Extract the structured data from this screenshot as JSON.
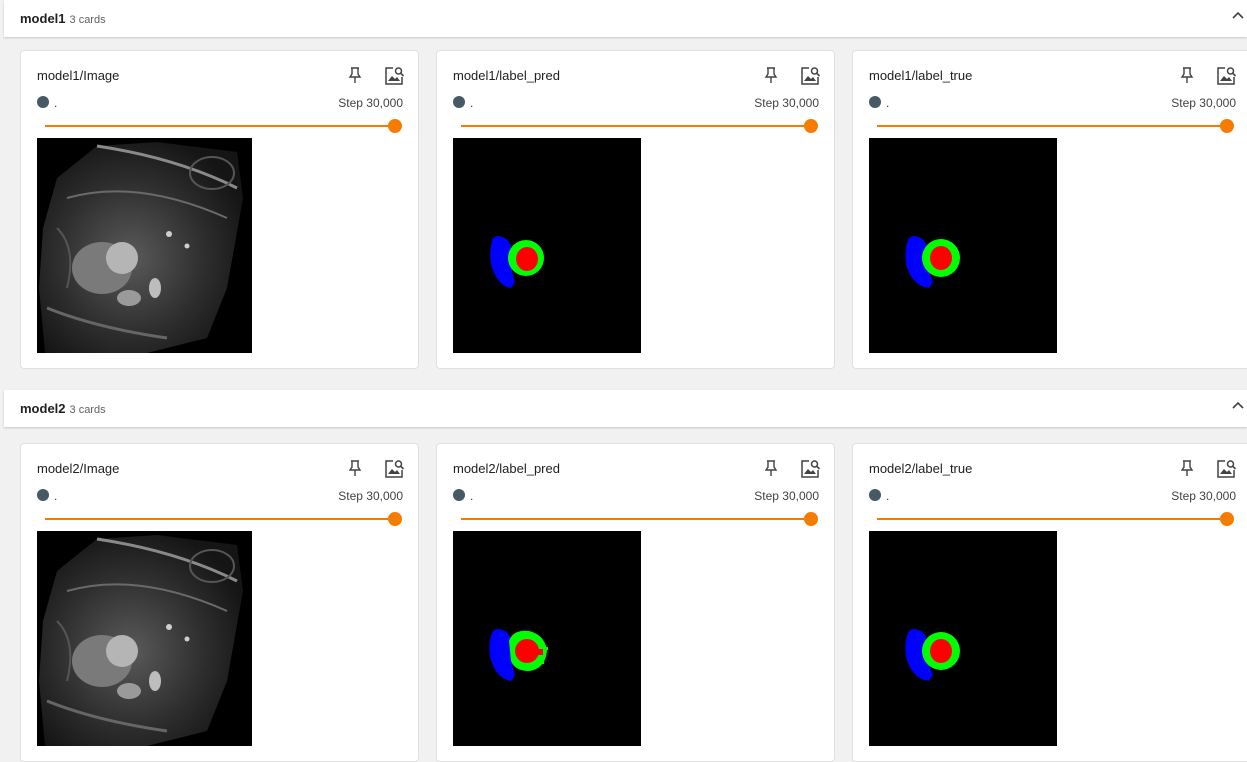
{
  "groups": [
    {
      "name": "model1",
      "count": "3 cards",
      "cards": [
        {
          "title": "model1/Image",
          "run": ".",
          "step": "Step 30,000",
          "kind": "mri"
        },
        {
          "title": "model1/label_pred",
          "run": ".",
          "step": "Step 30,000",
          "kind": "label"
        },
        {
          "title": "model1/label_true",
          "run": ".",
          "step": "Step 30,000",
          "kind": "label"
        }
      ]
    },
    {
      "name": "model2",
      "count": "3 cards",
      "cards": [
        {
          "title": "model2/Image",
          "run": ".",
          "step": "Step 30,000",
          "kind": "mri"
        },
        {
          "title": "model2/label_pred",
          "run": ".",
          "step": "Step 30,000",
          "kind": "label"
        },
        {
          "title": "model2/label_true",
          "run": ".",
          "step": "Step 30,000",
          "kind": "label"
        }
      ]
    }
  ],
  "icons": {
    "collapse": "chevron-up-icon",
    "pin": "pin-icon",
    "view": "image-search-icon"
  },
  "colors": {
    "accent": "#f57c00",
    "run_dot": "#455a64",
    "seg_blue": "#0000ff",
    "seg_green": "#00ff00",
    "seg_red": "#ff0000"
  },
  "slider": {
    "value_fraction": 1.0
  }
}
